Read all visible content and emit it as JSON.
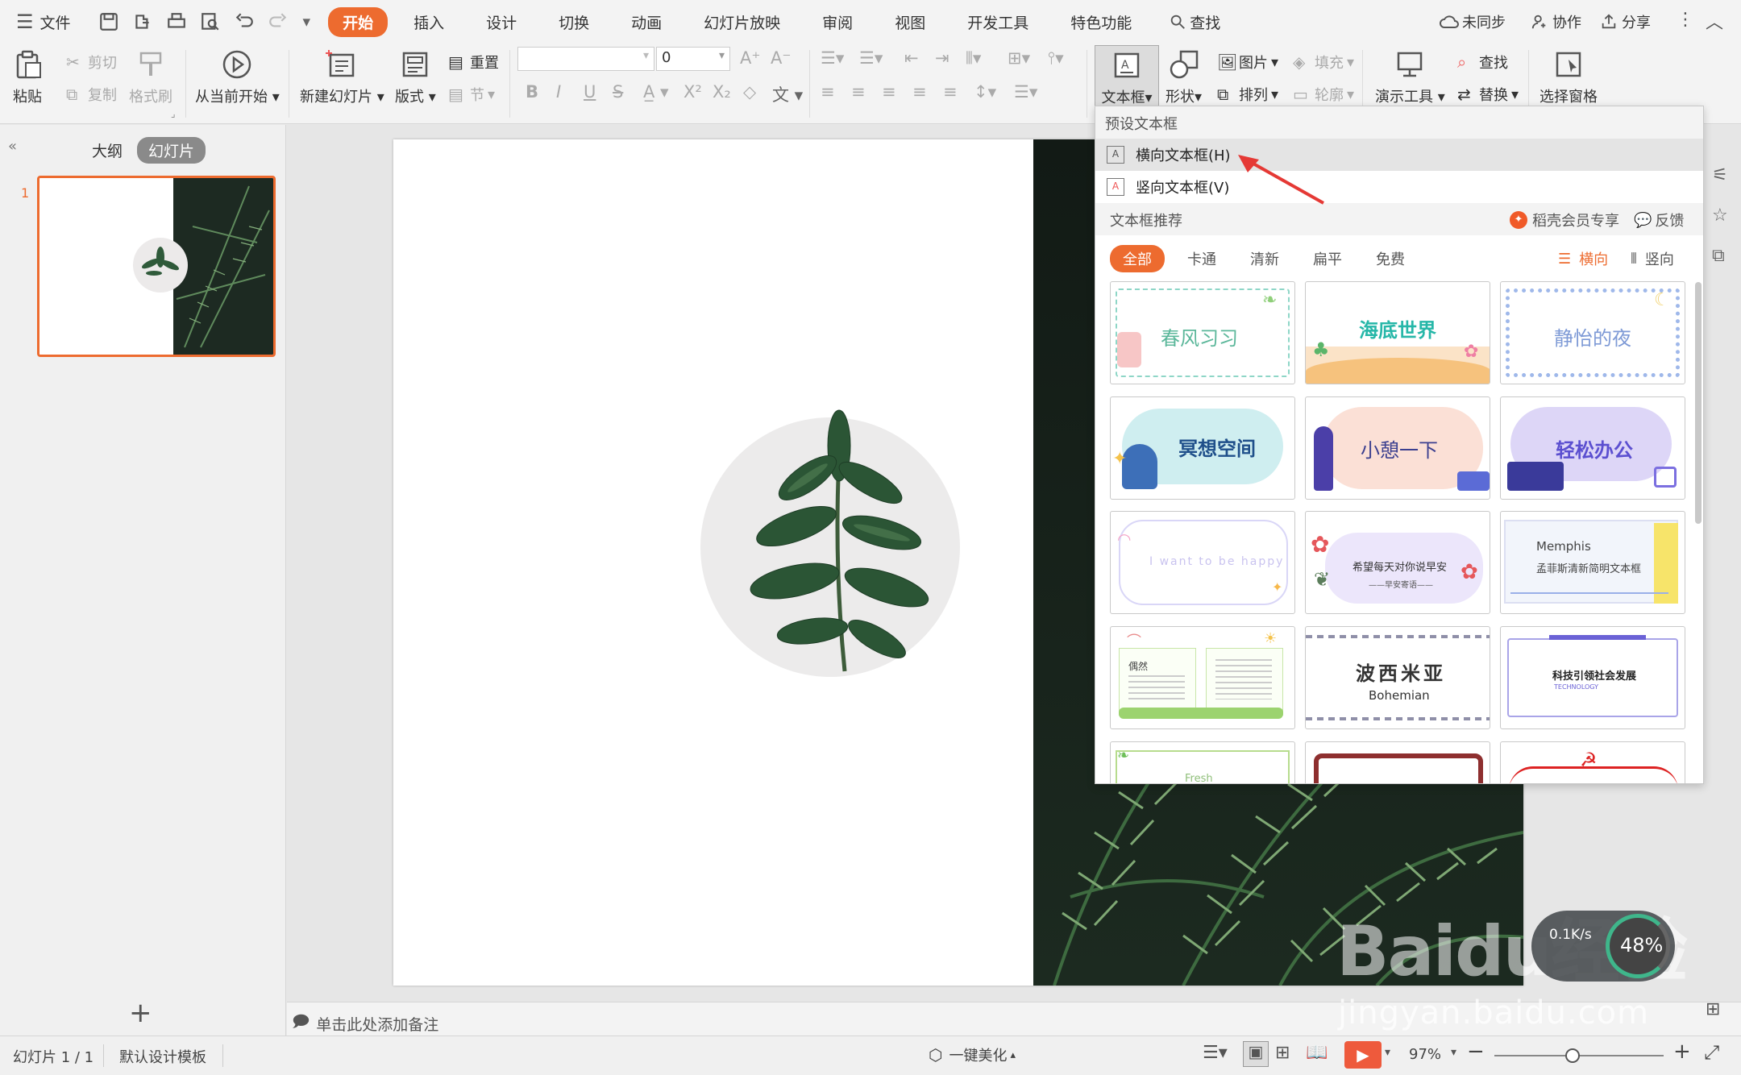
{
  "menubar": {
    "file_label": "文件",
    "tabs": [
      "开始",
      "插入",
      "设计",
      "切换",
      "动画",
      "幻灯片放映",
      "审阅",
      "视图",
      "开发工具",
      "特色功能"
    ],
    "search_label": "查找",
    "sync_label": "未同步",
    "collab_label": "协作",
    "share_label": "分享"
  },
  "ribbon": {
    "paste": "粘贴",
    "cut": "剪切",
    "copy": "复制",
    "format_painter": "格式刷",
    "from_current": "从当前开始",
    "new_slide": "新建幻灯片",
    "layout": "版式",
    "reset": "重置",
    "section": "节",
    "font_size": "0",
    "textbox": "文本框",
    "shape": "形状",
    "picture": "图片",
    "fill": "填充",
    "arrange": "排列",
    "outline": "轮廓",
    "presentation_tools": "演示工具",
    "find": "查找",
    "replace": "替换",
    "select_pane": "选择窗格"
  },
  "leftpanel": {
    "outline_tab": "大纲",
    "slides_tab": "幻灯片",
    "slide_number": "1"
  },
  "notes_placeholder": "单击此处添加备注",
  "dropdown": {
    "preset_header": "预设文本框",
    "horizontal": "横向文本框(H)",
    "vertical": "竖向文本框(V)",
    "recommend_header": "文本框推荐",
    "member_label": "稻壳会员专享",
    "feedback_label": "反馈",
    "filters": [
      "全部",
      "卡通",
      "清新",
      "扁平",
      "免费"
    ],
    "orient_horizontal": "横向",
    "orient_vertical": "竖向",
    "templates": [
      {
        "title": "春风习习"
      },
      {
        "title": "海底世界"
      },
      {
        "title": "静怡的夜"
      },
      {
        "title": "冥想空间"
      },
      {
        "title": "小憩一下"
      },
      {
        "title": "轻松办公"
      },
      {
        "title": "I want to be happy"
      },
      {
        "title": "希望每天对你说早安",
        "subtitle": "——早安寄语——"
      },
      {
        "title": "Memphis",
        "subtitle": "孟菲斯清新简明文本框"
      },
      {
        "title": "偶然"
      },
      {
        "title": "波西米亚",
        "subtitle": "Bohemian"
      },
      {
        "title": "科技引领社会发展",
        "subtitle": "TECHNOLOGY"
      },
      {
        "title": "Fresh"
      },
      {
        "title": ""
      },
      {
        "title": ""
      }
    ]
  },
  "status": {
    "slide_info": "幻灯片 1 / 1",
    "template": "默认设计模板",
    "beautify": "一键美化",
    "zoom": "97%"
  },
  "watermark": {
    "brand": "Baidu经验",
    "url": "jingyan.baidu.com",
    "speed": "0.1K/s",
    "percent": "48%"
  },
  "colors": {
    "accent": "#ed6b2f",
    "ribbon_bg": "#f3f3f3",
    "panel_bg": "#f0f0f0"
  }
}
